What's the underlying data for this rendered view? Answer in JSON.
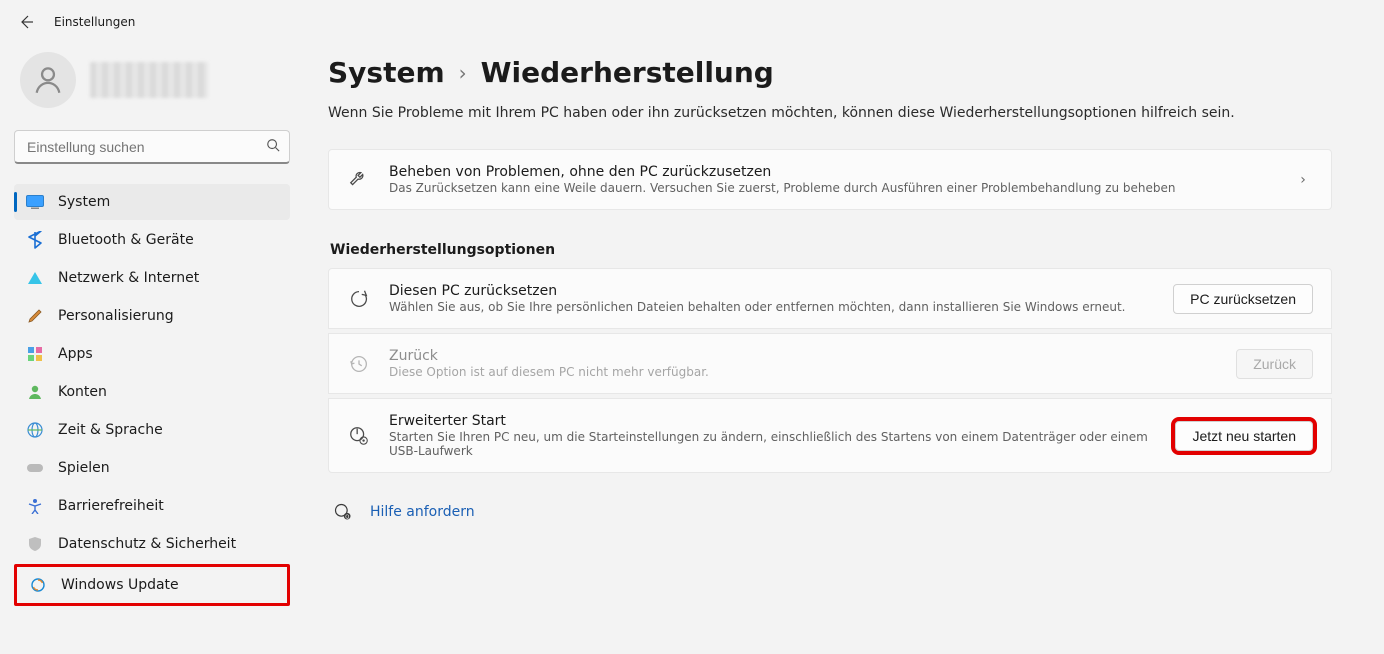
{
  "window": {
    "title": "Einstellungen"
  },
  "search": {
    "placeholder": "Einstellung suchen"
  },
  "sidebar": {
    "items": [
      {
        "label": "System",
        "icon": "system",
        "selected": true
      },
      {
        "label": "Bluetooth & Geräte",
        "icon": "bluetooth",
        "selected": false
      },
      {
        "label": "Netzwerk & Internet",
        "icon": "network",
        "selected": false
      },
      {
        "label": "Personalisierung",
        "icon": "personalize",
        "selected": false
      },
      {
        "label": "Apps",
        "icon": "apps",
        "selected": false
      },
      {
        "label": "Konten",
        "icon": "accounts",
        "selected": false
      },
      {
        "label": "Zeit & Sprache",
        "icon": "time",
        "selected": false
      },
      {
        "label": "Spielen",
        "icon": "gaming",
        "selected": false
      },
      {
        "label": "Barrierefreiheit",
        "icon": "accessibility",
        "selected": false
      },
      {
        "label": "Datenschutz & Sicherheit",
        "icon": "privacy",
        "selected": false
      },
      {
        "label": "Windows Update",
        "icon": "update",
        "selected": false,
        "highlight": true
      }
    ]
  },
  "breadcrumb": {
    "parent": "System",
    "current": "Wiederherstellung"
  },
  "page": {
    "description": "Wenn Sie Probleme mit Ihrem PC haben oder ihn zurücksetzen möchten, können diese Wiederherstellungsoptionen hilfreich sein."
  },
  "troubleshoot": {
    "title": "Beheben von Problemen, ohne den PC zurückzusetzen",
    "sub": "Das Zurücksetzen kann eine Weile dauern. Versuchen Sie zuerst, Probleme durch Ausführen einer Problembehandlung zu beheben"
  },
  "options": {
    "header": "Wiederherstellungsoptionen",
    "reset": {
      "title": "Diesen PC zurücksetzen",
      "sub": "Wählen Sie aus, ob Sie Ihre persönlichen Dateien behalten oder entfernen möchten, dann installieren Sie Windows erneut.",
      "button": "PC zurücksetzen"
    },
    "goBack": {
      "title": "Zurück",
      "sub": "Diese Option ist auf diesem PC nicht mehr verfügbar.",
      "button": "Zurück"
    },
    "advanced": {
      "title": "Erweiterter Start",
      "sub": "Starten Sie Ihren PC neu, um die Starteinstellungen zu ändern, einschließlich des Startens von einem Datenträger oder einem USB-Laufwerk",
      "button": "Jetzt neu starten"
    }
  },
  "help": {
    "label": "Hilfe anfordern"
  }
}
